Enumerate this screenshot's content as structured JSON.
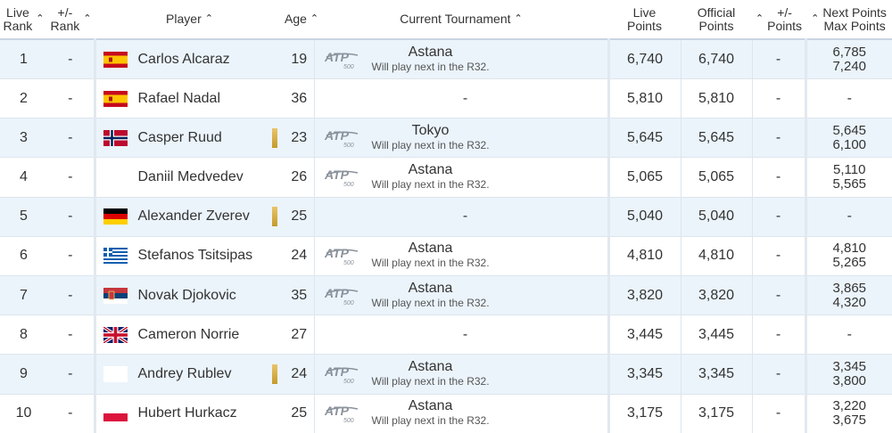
{
  "headers": {
    "live_rank": [
      "Live",
      "Rank"
    ],
    "rank_change": [
      "+/-",
      "Rank"
    ],
    "player": "Player",
    "age": "Age",
    "tournament": "Current Tournament",
    "live_points": [
      "Live",
      "Points"
    ],
    "official_points": [
      "Official",
      "Points"
    ],
    "points_change": [
      "+/-",
      "Points"
    ],
    "next_points": [
      "Next Points",
      "Max Points"
    ]
  },
  "icons": {
    "sort": "chevron-up-icon",
    "tournament_logo": "atp-500-logo",
    "medal": "gold-medal-icon"
  },
  "rows": [
    {
      "rank": "1",
      "change": "-",
      "flag": "ES",
      "player": "Carlos Alcaraz",
      "medal": false,
      "age": "19",
      "tournament": "Astana",
      "note": "Will play next in the R32.",
      "live": "6,740",
      "official": "6,740",
      "pchange": "-",
      "next": "6,785",
      "max": "7,240"
    },
    {
      "rank": "2",
      "change": "-",
      "flag": "ES",
      "player": "Rafael Nadal",
      "medal": false,
      "age": "36",
      "tournament": "-",
      "note": "",
      "live": "5,810",
      "official": "5,810",
      "pchange": "-",
      "next": "-",
      "max": ""
    },
    {
      "rank": "3",
      "change": "-",
      "flag": "NO",
      "player": "Casper Ruud",
      "medal": true,
      "age": "23",
      "tournament": "Tokyo",
      "note": "Will play next in the R32.",
      "live": "5,645",
      "official": "5,645",
      "pchange": "-",
      "next": "5,645",
      "max": "6,100"
    },
    {
      "rank": "4",
      "change": "-",
      "flag": "",
      "player": "Daniil Medvedev",
      "medal": false,
      "age": "26",
      "tournament": "Astana",
      "note": "Will play next in the R32.",
      "live": "5,065",
      "official": "5,065",
      "pchange": "-",
      "next": "5,110",
      "max": "5,565"
    },
    {
      "rank": "5",
      "change": "-",
      "flag": "DE",
      "player": "Alexander Zverev",
      "medal": true,
      "age": "25",
      "tournament": "-",
      "note": "",
      "live": "5,040",
      "official": "5,040",
      "pchange": "-",
      "next": "-",
      "max": ""
    },
    {
      "rank": "6",
      "change": "-",
      "flag": "GR",
      "player": "Stefanos Tsitsipas",
      "medal": false,
      "age": "24",
      "tournament": "Astana",
      "note": "Will play next in the R32.",
      "live": "4,810",
      "official": "4,810",
      "pchange": "-",
      "next": "4,810",
      "max": "5,265"
    },
    {
      "rank": "7",
      "change": "-",
      "flag": "RS",
      "player": "Novak Djokovic",
      "medal": false,
      "age": "35",
      "tournament": "Astana",
      "note": "Will play next in the R32.",
      "live": "3,820",
      "official": "3,820",
      "pchange": "-",
      "next": "3,865",
      "max": "4,320"
    },
    {
      "rank": "8",
      "change": "-",
      "flag": "GB",
      "player": "Cameron Norrie",
      "medal": false,
      "age": "27",
      "tournament": "-",
      "note": "",
      "live": "3,445",
      "official": "3,445",
      "pchange": "-",
      "next": "-",
      "max": ""
    },
    {
      "rank": "9",
      "change": "-",
      "flag": "",
      "player": "Andrey Rublev",
      "medal": true,
      "age": "24",
      "tournament": "Astana",
      "note": "Will play next in the R32.",
      "live": "3,345",
      "official": "3,345",
      "pchange": "-",
      "next": "3,345",
      "max": "3,800"
    },
    {
      "rank": "10",
      "change": "-",
      "flag": "PL",
      "player": "Hubert Hurkacz",
      "medal": false,
      "age": "25",
      "tournament": "Astana",
      "note": "Will play next in the R32.",
      "live": "3,175",
      "official": "3,175",
      "pchange": "-",
      "next": "3,220",
      "max": "3,675"
    }
  ]
}
